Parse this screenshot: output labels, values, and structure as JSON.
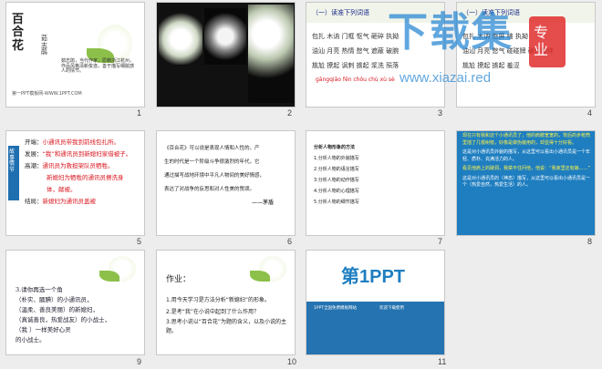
{
  "slides": [
    {
      "num": "1",
      "title": "百合花",
      "author": "茹志鹃",
      "bio": "茹志鹃，当代作家，原籍浙江杭州，作品风格清新俊逸，善于描写细腻感人的情节。",
      "footer": "第一PPT模板网-WWW.1PPT.COM"
    },
    {
      "num": "2"
    },
    {
      "num": "3",
      "heading": "（一）读准下列词语",
      "rows": [
        "包扎  木讷  门框  怄气  砸碎  执拗",
        "",
        "油汕  月亮  热情  憋气  遮蔽  破腕",
        "",
        "尴尬  撩起  讽刺  掳起  浆洗  殒落"
      ],
      "pinyin": "gāngqiāo    fēn    chōu chù   xù  sè"
    },
    {
      "num": "4",
      "heading": "（一）读准下列词语",
      "rows": [
        "包扎  木讷  憋屏  啵  执拗",
        "",
        "油汕  月亮  憋气  碰碰牌  破碎爆烊",
        "",
        "尴尬  撩起  掳起  羞涩"
      ]
    },
    {
      "num": "5",
      "side": "故事情节",
      "lines": [
        {
          "k": "开端：",
          "v": "小通讯员带我到前线包扎所。"
        },
        {
          "k": "发展：",
          "v": "“我”和通讯员到新媳妇家借被子。"
        },
        {
          "k": "高潮：",
          "v": "通讯员为救担架队员牺牲。"
        },
        {
          "k": "",
          "v": "新媳妇为牺牲的通讯员擦洗身"
        },
        {
          "k": "",
          "v": "体，献被。"
        },
        {
          "k": "结局：",
          "v": "新媳妇为通讯员盖被"
        }
      ]
    },
    {
      "num": "6",
      "text": [
        "《百合花》可以说是表现人情和人性的。产",
        "生的时代是一个阶级斗争很激烈的年代，它",
        "通过描写战地环境中平凡人物间的美好情感，",
        "表达了对战争的反思和对人性美的赞颂。"
      ],
      "sig": "——茅盾"
    },
    {
      "num": "7",
      "items": [
        "分析人物形象的方法",
        "1.分析人物的外貌描写",
        "2.分析人物的语言描写",
        "3.分析人物的动作描写",
        "4.分析人物的心理描写",
        "5.分析人物的细节描写"
      ]
    },
    {
      "num": "8",
      "paras": [
        "现在只有我和这个小通讯员了，他的肩膀宽宽的，背后的步枪筒里插了几根树枝，好像是做伪装用的，却显得十分好看。",
        "这是对小通讯员外貌的描写，从这里可以看出小通讯员是一个年轻、质朴、充满活力的人。",
        "看见他肩上的破洞，我禁不住问他，他说：“我家里还有娘……”",
        "这是对小通讯员的（神态）描写，从这里可以看出小通讯员是一个（热爱自然，热爱生活）的人。"
      ]
    },
    {
      "num": "9",
      "lines": [
        "3.请你再选一个角",
        "（朴实、腼腆）的小通讯员，",
        "（温柔、善良美丽）的新媳妇，",
        "（真诚善良，热爱战友）的小战士，",
        "（我 ）一样美好心灵",
        "的小战士。"
      ]
    },
    {
      "num": "10",
      "heading": "作业：",
      "items": [
        "1.用今天学习是方法分析“新媳妇”的形象。",
        "2.是考“我”在小说中起到了什么作用？",
        "3.思考小说以“百合花”为题的含义，以及小说的主题。"
      ]
    },
    {
      "num": "11",
      "logo": "第1PPT",
      "col1": "1PPT全国免费模板网站",
      "col2": "欢迎下载使用"
    }
  ],
  "watermark": {
    "main": "下载集",
    "tag": "专业",
    "url": "www.xiazai.red"
  }
}
